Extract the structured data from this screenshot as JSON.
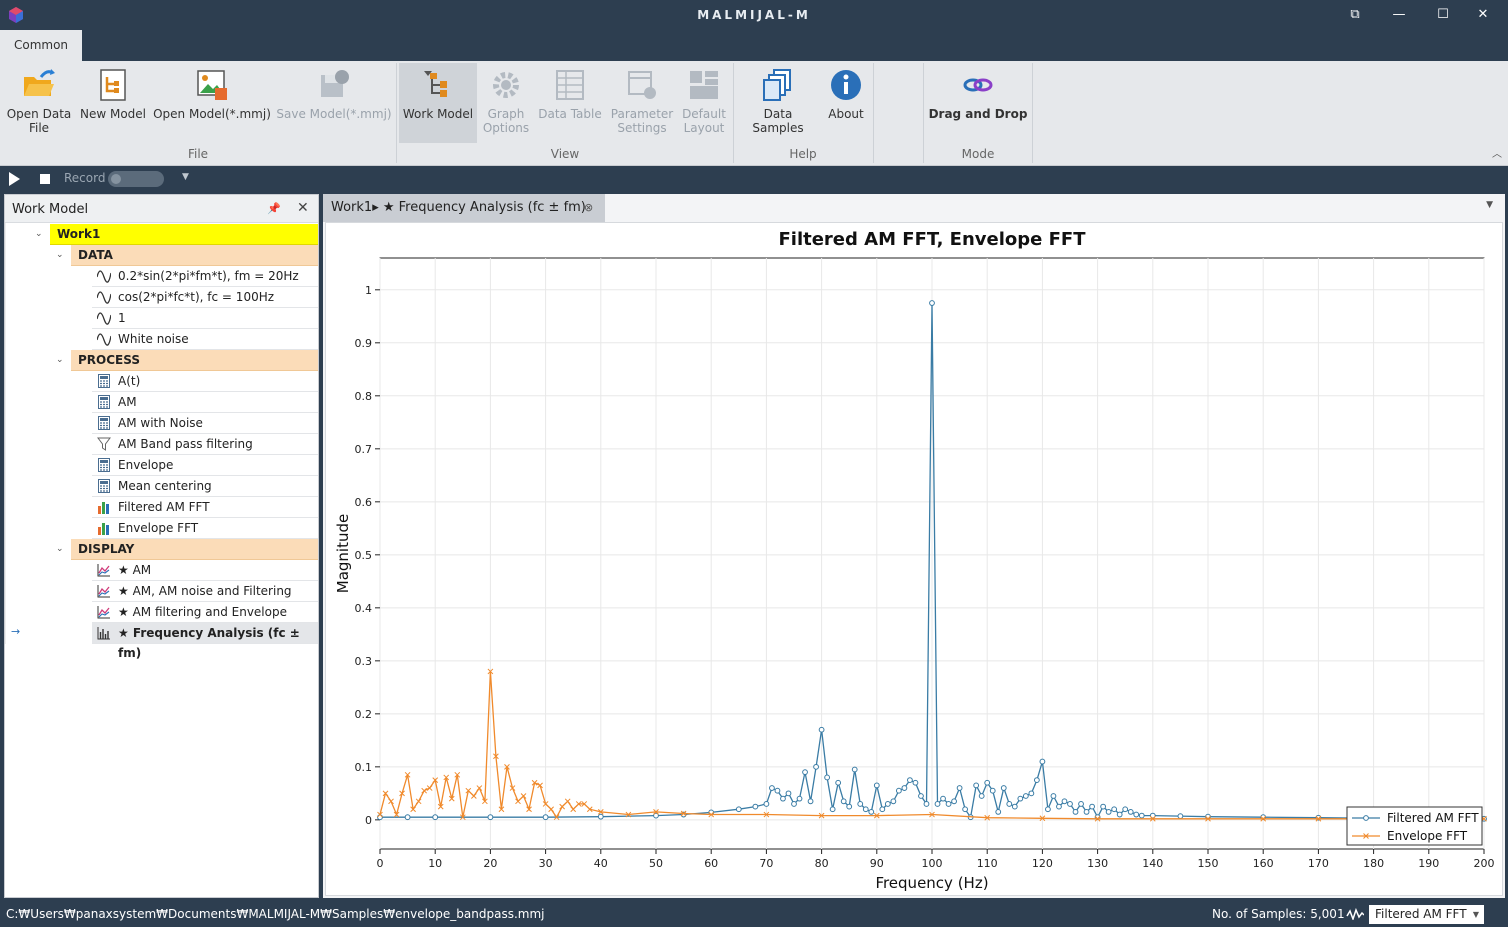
{
  "app": {
    "title": "MALMIJAL-M"
  },
  "ribbon_tab": "Common",
  "ribbon": {
    "open_data": "Open Data\nFile",
    "new_model": "New Model",
    "open_model": "Open Model(*.mmj)",
    "save_model": "Save Model(*.mmj)",
    "work_model": "Work Model",
    "graph_options": "Graph\nOptions",
    "data_table": "Data Table",
    "parameter_settings": "Parameter\nSettings",
    "default_layout": "Default\nLayout",
    "data_samples": "Data Samples",
    "about": "About",
    "drag_drop": "Drag and Drop",
    "groups": {
      "file": "File",
      "view": "View",
      "help": "Help",
      "mode": "Mode"
    }
  },
  "cmdbar": {
    "record": "Record"
  },
  "panel": {
    "title": "Work Model",
    "root": "Work1",
    "sections": [
      {
        "name": "DATA",
        "items": [
          {
            "label": "0.2*sin(2*pi*fm*t), fm = 20Hz",
            "icon": "wave-icon"
          },
          {
            "label": "cos(2*pi*fc*t), fc = 100Hz",
            "icon": "wave-icon"
          },
          {
            "label": "1",
            "icon": "wave-icon"
          },
          {
            "label": "White noise",
            "icon": "wave-icon"
          }
        ]
      },
      {
        "name": "PROCESS",
        "items": [
          {
            "label": "A(t)",
            "icon": "calculator-icon"
          },
          {
            "label": "AM",
            "icon": "calculator-icon"
          },
          {
            "label": "AM with Noise",
            "icon": "calculator-icon"
          },
          {
            "label": "AM Band pass filtering",
            "icon": "filter-icon"
          },
          {
            "label": "Envelope",
            "icon": "calculator-icon"
          },
          {
            "label": "Mean centering",
            "icon": "calculator-icon"
          },
          {
            "label": "Filtered AM FFT",
            "icon": "bar-chart-icon"
          },
          {
            "label": "Envelope FFT",
            "icon": "bar-chart-icon"
          }
        ]
      },
      {
        "name": "DISPLAY",
        "items": [
          {
            "label": "★ AM",
            "icon": "line-chart-icon"
          },
          {
            "label": "★ AM, AM noise and Filtering",
            "icon": "line-chart-icon"
          },
          {
            "label": "★ AM filtering and Envelope",
            "icon": "line-chart-icon"
          },
          {
            "label": "★ Frequency Analysis (fc ± fm)",
            "icon": "histogram-icon"
          }
        ]
      }
    ]
  },
  "doc_tab": {
    "label": "Work1▸ ★ Frequency Analysis (fc ± fm)"
  },
  "chart_data": {
    "type": "line",
    "title": "Filtered AM FFT, Envelope FFT",
    "xlabel": "Frequency (Hz)",
    "ylabel": "Magnitude",
    "xlim": [
      0,
      200
    ],
    "ylim": [
      -0.055,
      1.06
    ],
    "xticks": [
      0,
      10,
      20,
      30,
      40,
      50,
      60,
      70,
      80,
      90,
      100,
      110,
      120,
      130,
      140,
      150,
      160,
      170,
      180,
      190,
      200
    ],
    "yticks": [
      0,
      0.1,
      0.2,
      0.3,
      0.4,
      0.5,
      0.6,
      0.7,
      0.8,
      0.9,
      1
    ],
    "grid": true,
    "legend": "bottom-right",
    "series": [
      {
        "name": "Filtered AM FFT",
        "color": "#3a7ca5",
        "marker": "circle",
        "points": [
          [
            0,
            0.005
          ],
          [
            5,
            0.005
          ],
          [
            10,
            0.005
          ],
          [
            20,
            0.005
          ],
          [
            30,
            0.005
          ],
          [
            40,
            0.006
          ],
          [
            50,
            0.008
          ],
          [
            55,
            0.01
          ],
          [
            60,
            0.014
          ],
          [
            65,
            0.02
          ],
          [
            68,
            0.025
          ],
          [
            70,
            0.03
          ],
          [
            71,
            0.06
          ],
          [
            72,
            0.055
          ],
          [
            73,
            0.04
          ],
          [
            74,
            0.05
          ],
          [
            75,
            0.03
          ],
          [
            76,
            0.04
          ],
          [
            77,
            0.09
          ],
          [
            78,
            0.035
          ],
          [
            79,
            0.1
          ],
          [
            80,
            0.17
          ],
          [
            81,
            0.08
          ],
          [
            82,
            0.02
          ],
          [
            83,
            0.07
          ],
          [
            84,
            0.035
          ],
          [
            85,
            0.025
          ],
          [
            86,
            0.095
          ],
          [
            87,
            0.03
          ],
          [
            88,
            0.02
          ],
          [
            89,
            0.015
          ],
          [
            90,
            0.065
          ],
          [
            91,
            0.02
          ],
          [
            92,
            0.03
          ],
          [
            93,
            0.035
          ],
          [
            94,
            0.055
          ],
          [
            95,
            0.06
          ],
          [
            96,
            0.075
          ],
          [
            97,
            0.07
          ],
          [
            98,
            0.045
          ],
          [
            99,
            0.03
          ],
          [
            100,
            0.975
          ],
          [
            101,
            0.03
          ],
          [
            102,
            0.04
          ],
          [
            103,
            0.03
          ],
          [
            104,
            0.035
          ],
          [
            105,
            0.06
          ],
          [
            106,
            0.02
          ],
          [
            107,
            0.005
          ],
          [
            108,
            0.065
          ],
          [
            109,
            0.045
          ],
          [
            110,
            0.07
          ],
          [
            111,
            0.055
          ],
          [
            112,
            0.015
          ],
          [
            113,
            0.06
          ],
          [
            114,
            0.03
          ],
          [
            115,
            0.025
          ],
          [
            116,
            0.04
          ],
          [
            117,
            0.045
          ],
          [
            118,
            0.05
          ],
          [
            119,
            0.075
          ],
          [
            120,
            0.11
          ],
          [
            121,
            0.02
          ],
          [
            122,
            0.045
          ],
          [
            123,
            0.025
          ],
          [
            124,
            0.035
          ],
          [
            125,
            0.03
          ],
          [
            126,
            0.015
          ],
          [
            127,
            0.03
          ],
          [
            128,
            0.015
          ],
          [
            129,
            0.025
          ],
          [
            130,
            0.005
          ],
          [
            131,
            0.025
          ],
          [
            132,
            0.015
          ],
          [
            133,
            0.02
          ],
          [
            134,
            0.01
          ],
          [
            135,
            0.02
          ],
          [
            136,
            0.015
          ],
          [
            137,
            0.01
          ],
          [
            138,
            0.008
          ],
          [
            140,
            0.008
          ],
          [
            145,
            0.007
          ],
          [
            150,
            0.006
          ],
          [
            160,
            0.005
          ],
          [
            170,
            0.004
          ],
          [
            180,
            0.003
          ],
          [
            190,
            0.003
          ],
          [
            200,
            0.002
          ]
        ]
      },
      {
        "name": "Envelope FFT",
        "color": "#f08a2c",
        "marker": "x",
        "points": [
          [
            0,
            0.01
          ],
          [
            1,
            0.05
          ],
          [
            2,
            0.035
          ],
          [
            3,
            0.01
          ],
          [
            4,
            0.05
          ],
          [
            5,
            0.085
          ],
          [
            6,
            0.02
          ],
          [
            7,
            0.035
          ],
          [
            8,
            0.055
          ],
          [
            9,
            0.06
          ],
          [
            10,
            0.075
          ],
          [
            11,
            0.025
          ],
          [
            12,
            0.08
          ],
          [
            13,
            0.04
          ],
          [
            14,
            0.085
          ],
          [
            15,
            0.005
          ],
          [
            16,
            0.055
          ],
          [
            17,
            0.045
          ],
          [
            18,
            0.06
          ],
          [
            19,
            0.035
          ],
          [
            20,
            0.28
          ],
          [
            21,
            0.12
          ],
          [
            22,
            0.02
          ],
          [
            23,
            0.1
          ],
          [
            24,
            0.06
          ],
          [
            25,
            0.035
          ],
          [
            26,
            0.045
          ],
          [
            27,
            0.02
          ],
          [
            28,
            0.07
          ],
          [
            29,
            0.065
          ],
          [
            30,
            0.03
          ],
          [
            31,
            0.02
          ],
          [
            32,
            0.005
          ],
          [
            33,
            0.025
          ],
          [
            34,
            0.035
          ],
          [
            35,
            0.02
          ],
          [
            36,
            0.03
          ],
          [
            37,
            0.03
          ],
          [
            38,
            0.02
          ],
          [
            40,
            0.015
          ],
          [
            45,
            0.01
          ],
          [
            50,
            0.015
          ],
          [
            55,
            0.012
          ],
          [
            60,
            0.01
          ],
          [
            70,
            0.01
          ],
          [
            80,
            0.008
          ],
          [
            90,
            0.008
          ],
          [
            100,
            0.01
          ],
          [
            110,
            0.004
          ],
          [
            120,
            0.003
          ],
          [
            130,
            0.002
          ],
          [
            140,
            0.002
          ],
          [
            150,
            0.002
          ],
          [
            160,
            0.002
          ],
          [
            170,
            0.002
          ],
          [
            180,
            0.002
          ],
          [
            190,
            0.002
          ],
          [
            200,
            0.002
          ]
        ]
      }
    ]
  },
  "status": {
    "path": "C:₩Users₩panaxsystem₩Documents₩MALMIJAL-M₩Samples₩envelope_bandpass.mmj",
    "samples": "No. of Samples: 5,001",
    "series_select": "Filtered AM FFT"
  }
}
